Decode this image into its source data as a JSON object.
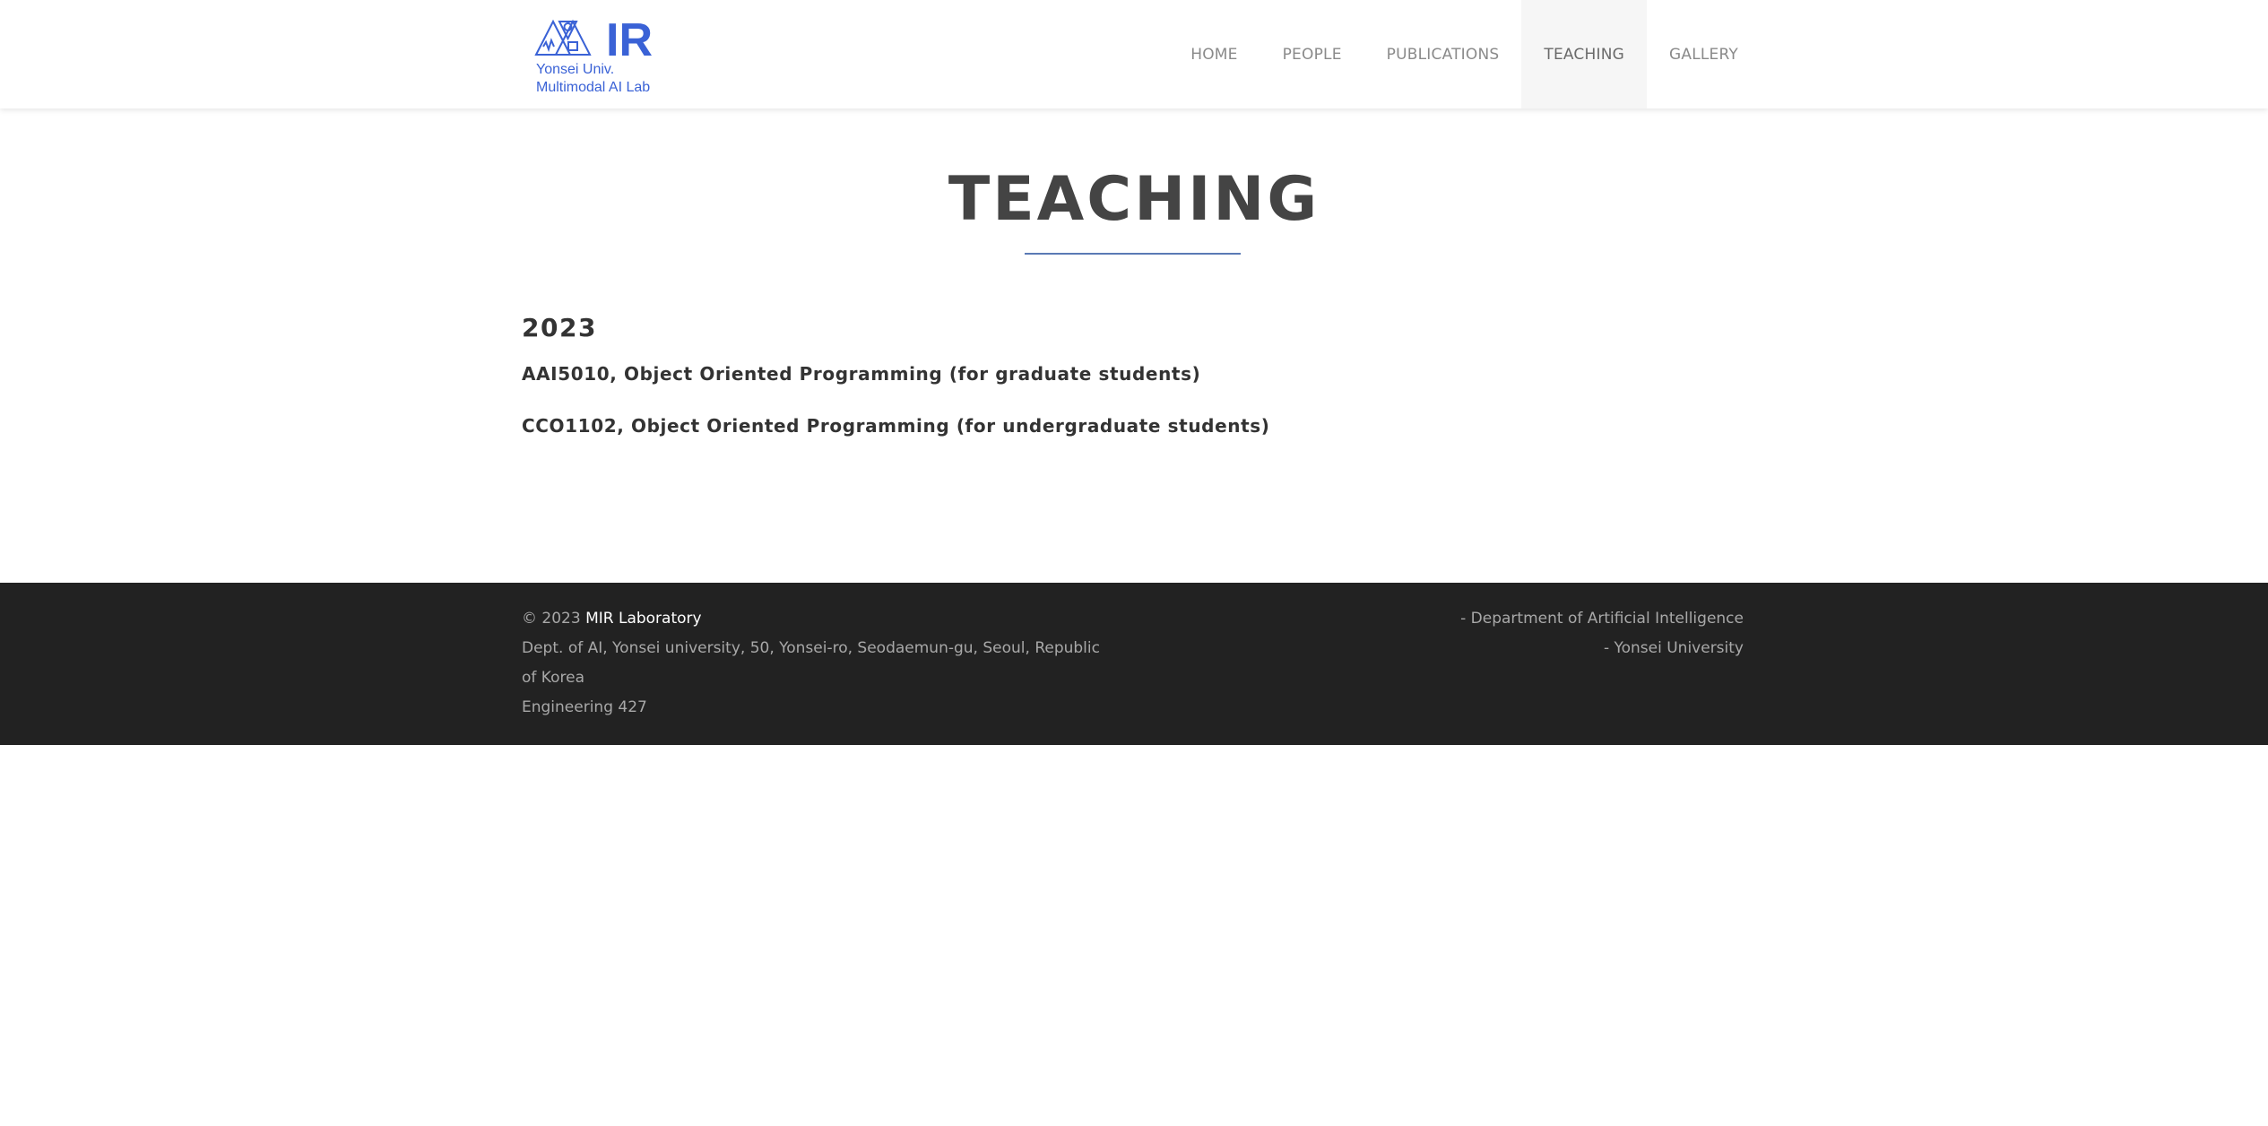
{
  "brand": {
    "logo_text": "IR",
    "line1": "Yonsei Univ.",
    "line2": "Multimodal AI Lab",
    "color": "#3a62d6"
  },
  "nav": {
    "items": [
      {
        "label": "HOME",
        "active": false
      },
      {
        "label": "PEOPLE",
        "active": false
      },
      {
        "label": "PUBLICATIONS",
        "active": false
      },
      {
        "label": "TEACHING",
        "active": true
      },
      {
        "label": "GALLERY",
        "active": false
      }
    ]
  },
  "page": {
    "title": "TEACHING",
    "underline_color": "#5a7ab5"
  },
  "teaching": {
    "year": "2023",
    "courses": [
      "AAI5010, Object Oriented Programming (for graduate students)",
      "CCO1102, Object Oriented Programming (for undergraduate students)"
    ]
  },
  "footer": {
    "copyright": "© 2023",
    "lab_name": "MIR Laboratory",
    "address": "Dept. of AI, Yonsei university, 50, Yonsei-ro, Seodaemun-gu, Seoul, Republic of Korea",
    "room": "Engineering 427",
    "right_lines": [
      "- Department of Artificial Intelligence",
      "- Yonsei University"
    ],
    "background": "#222222"
  }
}
